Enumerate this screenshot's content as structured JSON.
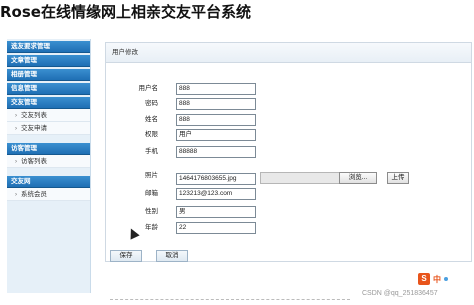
{
  "app": {
    "title": "Rose在线情缘网上相亲交友平台系统"
  },
  "sidebar": {
    "groups": [
      {
        "label": "选友要求管理",
        "items": []
      },
      {
        "label": "文章管理",
        "items": []
      },
      {
        "label": "相册管理",
        "items": []
      },
      {
        "label": "信息管理",
        "items": []
      },
      {
        "label": "交友管理",
        "items": [
          "交友列表",
          "交友申请"
        ]
      },
      {
        "label": "访客管理",
        "items": [
          "访客列表"
        ]
      },
      {
        "label": "交友网",
        "items": [
          "系统会员"
        ]
      }
    ]
  },
  "main": {
    "header": "用户修改",
    "fields": {
      "username": {
        "label": "用户名",
        "value": "888"
      },
      "password": {
        "label": "密码",
        "value": "888"
      },
      "name": {
        "label": "姓名",
        "value": "888"
      },
      "role": {
        "label": "权限",
        "value": "用户"
      },
      "phone": {
        "label": "手机",
        "value": "88888"
      },
      "photo": {
        "label": "照片",
        "value": "1464176803655.jpg"
      },
      "email": {
        "label": "邮箱",
        "value": "123213@123.com"
      },
      "gender": {
        "label": "性别",
        "value": "男"
      },
      "age": {
        "label": "年龄",
        "value": "22"
      }
    },
    "browse_label": "浏览...",
    "upload_label": "上传",
    "save_label": "保存",
    "cancel_label": "取消"
  },
  "footer": {
    "watermark": "CSDN @qq_251836457",
    "ime_label": "中"
  },
  "icons": {
    "chevron": "chevron-right-icon",
    "cursor": "mouse-cursor-icon",
    "ime": "sogou-ime-icon"
  },
  "colors": {
    "menu_head": "#1f6fb4",
    "sidebar_bg": "#e6f0f8",
    "ime": "#e8541b"
  }
}
